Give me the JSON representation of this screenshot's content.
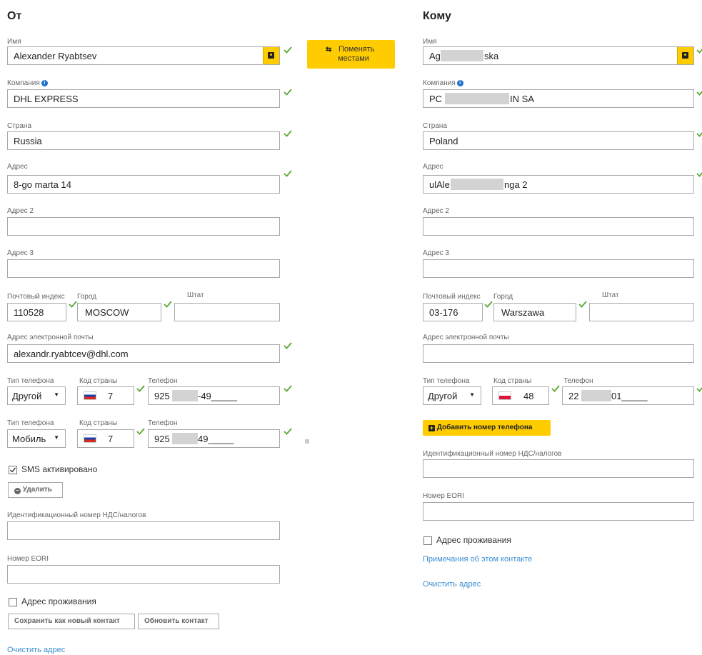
{
  "from": {
    "heading": "От",
    "name_label": "Имя",
    "name_value": "Alexander Ryabtsev",
    "company_label": "Компания",
    "company_value": "DHL EXPRESS",
    "country_label": "Страна",
    "country_value": "Russia",
    "address_label": "Адрес",
    "address_value": "8-go marta 14",
    "address2_label": "Адрес 2",
    "address3_label": "Адрес 3",
    "postcode_label": "Почтовый индекс",
    "postcode_value": "110528",
    "city_label": "Город",
    "city_value": "MOSCOW",
    "state_label": "Штат",
    "email_label": "Адрес электронной почты",
    "email_value": "alexandr.ryabtcev@dhl.com",
    "phone1": {
      "type_label": "Тип телефона",
      "type_value": "Другой",
      "code_label": "Код страны",
      "code_value": "7",
      "phone_label": "Телефон",
      "phone_prefix": "925",
      "phone_suffix": "-49_____"
    },
    "phone2": {
      "type_label": "Тип телефона",
      "type_value": "Мобиль",
      "code_label": "Код страны",
      "code_value": "7",
      "phone_label": "Телефон",
      "phone_prefix": "925",
      "phone_suffix": "49_____"
    },
    "sms_label": "SMS активировано",
    "delete_label": "Удалить",
    "vat_label": "Идентификационный номер НДС/налогов",
    "eori_label": "Номер EORI",
    "residential_label": "Адрес проживания",
    "save_new_label": "Сохранить как новый контакт",
    "update_label": "Обновить контакт",
    "clear_label": "Очистить адрес"
  },
  "swap": {
    "line1": "Поменять",
    "line2": "местами"
  },
  "to": {
    "heading": "Кому",
    "name_label": "Имя",
    "name_prefix": "Ag",
    "name_suffix": "ska",
    "company_label": "Компания",
    "company_prefix": "PC",
    "company_suffix": "IN SA",
    "country_label": "Страна",
    "country_value": "Poland",
    "address_label": "Адрес",
    "address_prefix": "ulAle",
    "address_suffix": "nga 2",
    "address2_label": "Адрес 2",
    "address3_label": "Адрес 3",
    "postcode_label": "Почтовый индекс",
    "postcode_value": "03-176",
    "city_label": "Город",
    "city_value": "Warszawa",
    "state_label": "Штат",
    "email_label": "Адрес электронной почты",
    "phone1": {
      "type_label": "Тип телефона",
      "type_value": "Другой",
      "code_label": "Код страны",
      "code_value": "48",
      "phone_label": "Телефон",
      "phone_prefix": "22",
      "phone_suffix": "01_____"
    },
    "add_phone_label": "Добавить номер телефона",
    "vat_label": "Идентификационный номер НДС/налогов",
    "eori_label": "Номер EORI",
    "residential_label": "Адрес проживания",
    "notes_label": "Примечания об этом контакте",
    "clear_label": "Очистить адрес"
  },
  "colors": {
    "accent_yellow": "#ffcc00",
    "check_green": "#5aa832",
    "link_blue": "#3d8fd1"
  },
  "icons": [
    "address-book-icon",
    "check-icon",
    "swap-arrows-icon",
    "info-icon",
    "minus-circle-icon",
    "plus-square-icon",
    "flag-russia-icon",
    "flag-poland-icon",
    "dropdown-arrow-icon"
  ]
}
